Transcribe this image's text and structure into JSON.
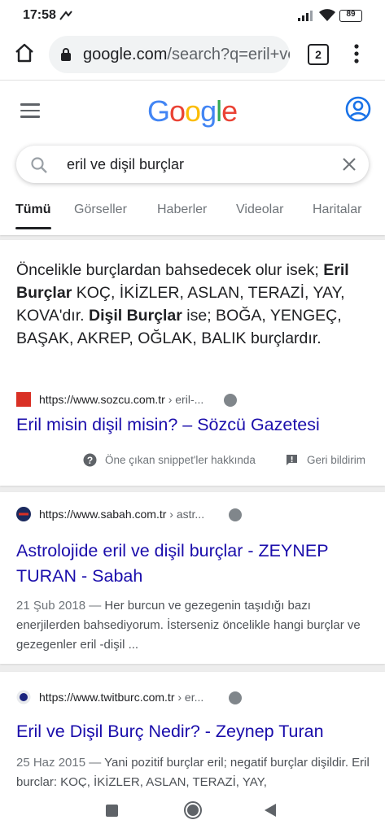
{
  "status_bar": {
    "time": "17:58",
    "battery": "89"
  },
  "browser": {
    "url_host": "google.com",
    "url_path": "/search?q=eril+ve",
    "tab_count": "2"
  },
  "search": {
    "query": "eril ve dişil burçlar",
    "tabs": [
      "Tümü",
      "Görseller",
      "Haberler",
      "Videolar",
      "Haritalar"
    ]
  },
  "featured": {
    "snippet_pre": "Öncelikle burçlardan bahsedecek olur isek;",
    "snippet_bold1": "Eril Burçlar",
    "snippet_mid": "KOÇ, İKİZLER, ASLAN, TERAZİ, YAY, KOVA'dır.",
    "snippet_bold2": "Dişil Burçlar",
    "snippet_post": "ise; BOĞA, YENGEÇ, BAŞAK, AKREP, OĞLAK, BALIK burçlardır.",
    "site_url": "https://www.sozcu.com.tr",
    "site_path": "› eril-...",
    "title": "Eril misin dişil misin? – Sözcü Gazetesi",
    "about_label": "Öne çıkan snippet'ler hakkında",
    "feedback_label": "Geri bildirim"
  },
  "results": [
    {
      "site_url": "https://www.sabah.com.tr",
      "site_path": "› astr...",
      "title": "Astrolojide eril ve dişil burçlar - ZEYNEP TURAN - Sabah",
      "date": "21 Şub 2018 —",
      "snippet": "Her burcun ve gezegenin taşıdığı bazı enerjilerden bahsediyorum. İsterseniz öncelikle hangi burçlar ve gezegenler eril -dişil ..."
    },
    {
      "site_url": "https://www.twitburc.com.tr",
      "site_path": "› er...",
      "title": "Eril ve Dişil Burç Nedir? - Zeynep Turan",
      "date": "25 Haz 2015 —",
      "snippet": "Yani pozitif burçlar eril; negatif burçlar dişildir. Eril burclar: KOÇ, İKİZLER, ASLAN, TERAZİ, YAY,"
    }
  ],
  "colors": {
    "link": "#1a0dab",
    "google_blue": "#4285f4",
    "google_red": "#ea4335",
    "google_yellow": "#fbbc05",
    "google_green": "#34a853"
  }
}
